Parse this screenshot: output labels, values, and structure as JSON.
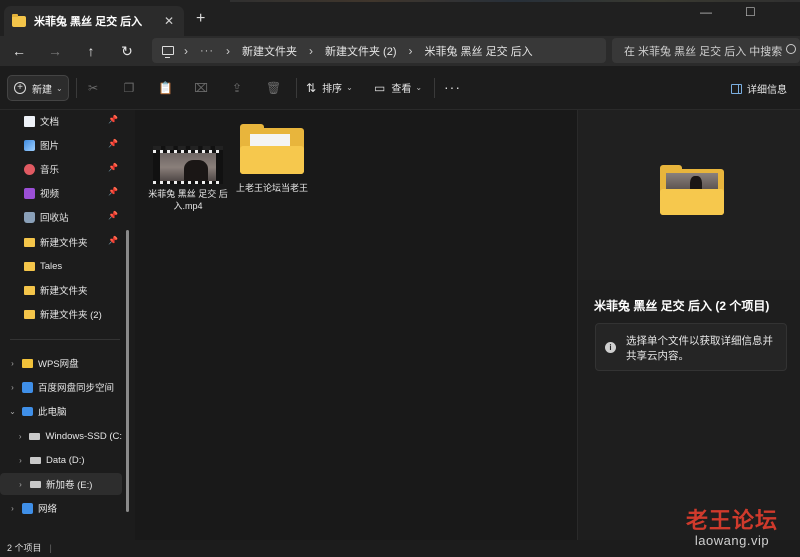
{
  "window": {
    "tab_title": "米菲兔 黑丝 足交 后入",
    "tab_close": "✕",
    "new_tab": "+",
    "minimize": "—",
    "maximize": "☐"
  },
  "address": {
    "more": "···",
    "crumbs": [
      "新建文件夹",
      "新建文件夹 (2)",
      "米菲兔 黑丝 足交 后入"
    ],
    "search_placeholder": "在 米菲兔 黑丝 足交 后入 中搜索"
  },
  "toolbar": {
    "new_label": "新建",
    "sort_label": "排序",
    "view_label": "查看",
    "more_label": "···",
    "details_label": "详细信息"
  },
  "sidebar": {
    "quick_access": [
      {
        "label": "文档",
        "icon": "documents-icon"
      },
      {
        "label": "图片",
        "icon": "pictures-icon"
      },
      {
        "label": "音乐",
        "icon": "music-icon"
      },
      {
        "label": "视频",
        "icon": "videos-icon"
      },
      {
        "label": "回收站",
        "icon": "recycle-bin-icon"
      },
      {
        "label": "新建文件夹",
        "icon": "folder-icon"
      },
      {
        "label": "Tales",
        "icon": "folder-icon"
      },
      {
        "label": "新建文件夹",
        "icon": "folder-icon"
      },
      {
        "label": "新建文件夹 (2)",
        "icon": "folder-icon"
      }
    ],
    "tree": [
      {
        "label": "WPS网盘"
      },
      {
        "label": "百度网盘同步空间"
      },
      {
        "label": "此电脑"
      },
      {
        "label": "Windows-SSD (C:"
      },
      {
        "label": "Data (D:)"
      },
      {
        "label": "新加卷 (E:)"
      },
      {
        "label": "网络"
      }
    ]
  },
  "files": [
    {
      "name": "米菲兔 黑丝 足交 后入.mp4",
      "type": "video"
    },
    {
      "name": "上老王论坛当老王",
      "type": "folder"
    }
  ],
  "details_pane": {
    "title": "米菲兔 黑丝 足交 后入 (2 个项目)",
    "info": "选择单个文件以获取详细信息并共享云内容。"
  },
  "status": {
    "count": "2 个项目",
    "sep": "|"
  },
  "watermark": {
    "title": "老王论坛",
    "url": "laowang.vip"
  },
  "colors": {
    "folder": "#f4c54a",
    "accent": "#7aaee0",
    "watermark": "#cf3a2c"
  }
}
